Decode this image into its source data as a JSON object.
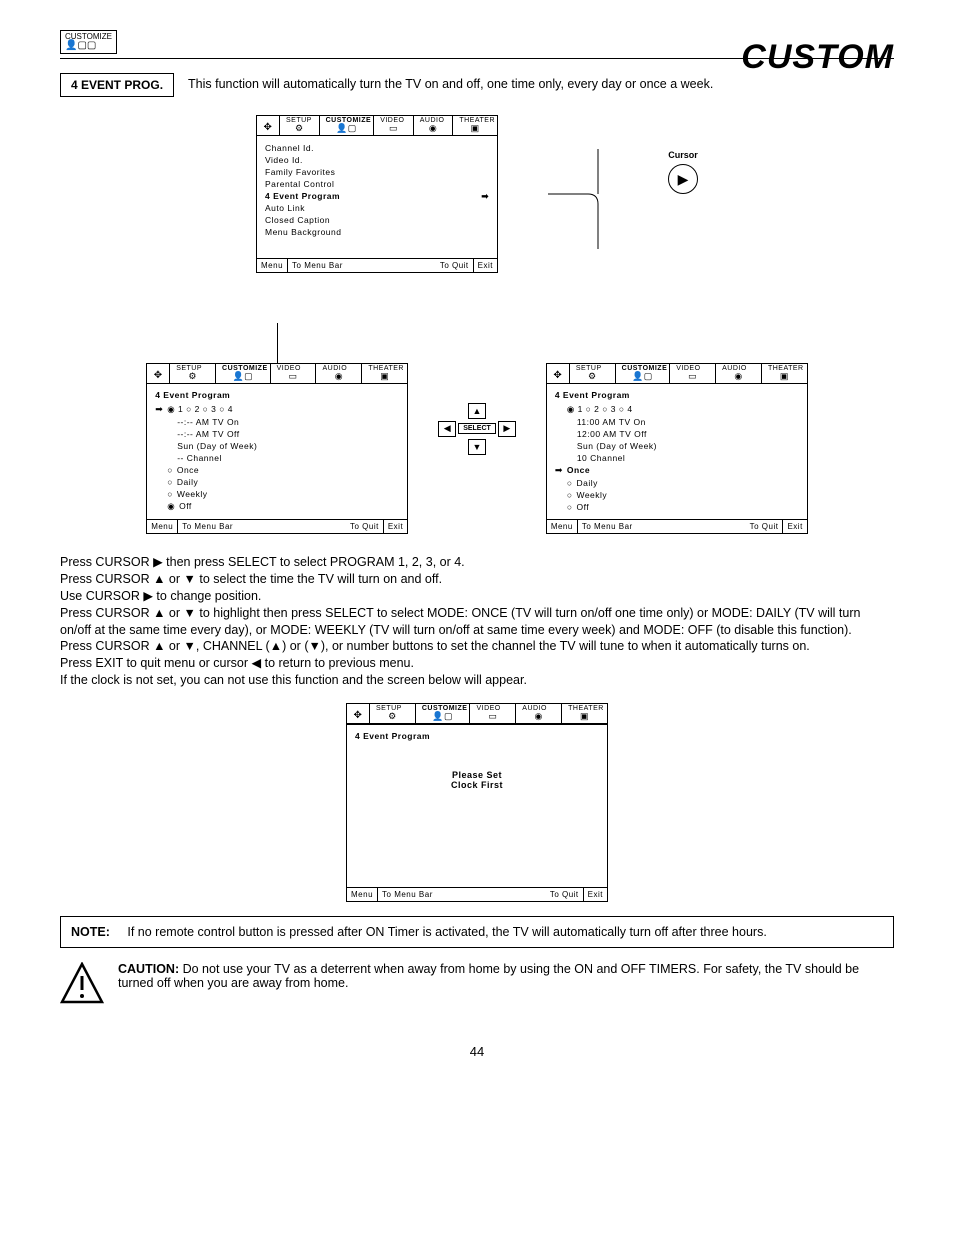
{
  "header": {
    "badge_label": "CUSTOMIZE",
    "page_title": "CUSTOM",
    "box_label": "4 EVENT PROG.",
    "intro": "This function will automatically turn the TV on and off, one time only, every day or once a week."
  },
  "tabs": {
    "setup": "SETUP",
    "customize": "CUSTOMIZE",
    "video": "VIDEO",
    "audio": "AUDIO",
    "theater": "THEATER"
  },
  "cursor_label": "Cursor",
  "select_label": "SELECT",
  "osd_customize": {
    "items": [
      "Channel Id.",
      "Video Id.",
      "Family Favorites",
      "Parental Control",
      "4 Event Program",
      "Auto Link",
      "Closed Caption",
      "Menu Background"
    ],
    "selected_index": 4
  },
  "osd_footer": {
    "menu": "Menu",
    "to_menu_bar": "To Menu Bar",
    "to_quit": "To Quit",
    "exit": "Exit"
  },
  "osd_left": {
    "title": "4 Event Program",
    "prog_row": "1     2     3     4",
    "rows": [
      "--:-- AM TV On",
      "--:-- AM TV Off",
      "Sun (Day of Week)",
      "-- Channel"
    ],
    "modes": [
      "Once",
      "Daily",
      "Weekly",
      "Off"
    ],
    "mode_selected": 3
  },
  "osd_right": {
    "title": "4 Event Program",
    "prog_row": "1     2     3     4",
    "rows": [
      "11:00 AM TV On",
      "12:00 AM TV Off",
      "Sun  (Day of Week)",
      "10 Channel"
    ],
    "modes": [
      "Once",
      "Daily",
      "Weekly",
      "Off"
    ],
    "mode_selected": 0
  },
  "osd_clock": {
    "title": "4 Event Program",
    "message_l1": "Please Set",
    "message_l2": "Clock First"
  },
  "instructions": {
    "l1": "Press CURSOR ▶ then press SELECT to select PROGRAM 1, 2, 3, or 4.",
    "l2": "Press CURSOR ▲ or ▼ to select the time the TV will turn on and off.",
    "l3": "Use CURSOR ▶ to change position.",
    "l4": "Press CURSOR ▲ or ▼ to highlight then press SELECT to select MODE: ONCE (TV will turn on/off one time only) or MODE: DAILY (TV will turn on/off at the same time every day), or MODE: WEEKLY (TV will turn on/off at same time every week) and MODE: OFF (to disable this function).",
    "l5": "Press CURSOR ▲ or ▼, CHANNEL (▲) or (▼), or number buttons to set the channel the TV will tune to when it automatically turns on.",
    "l6": "Press EXIT to quit menu or cursor ◀ to return to previous menu.",
    "l7": "If the clock is not set, you can not use this function and the screen below will appear."
  },
  "note": {
    "label": "NOTE:",
    "text": "If no remote control button is pressed after ON Timer is activated, the TV will automatically turn off after three hours."
  },
  "caution": {
    "label": "CAUTION:",
    "text": "Do not use your TV as a deterrent when away from home by using the ON and OFF TIMERS.  For safety, the TV should be turned off when you are away from home."
  },
  "page_number": "44"
}
